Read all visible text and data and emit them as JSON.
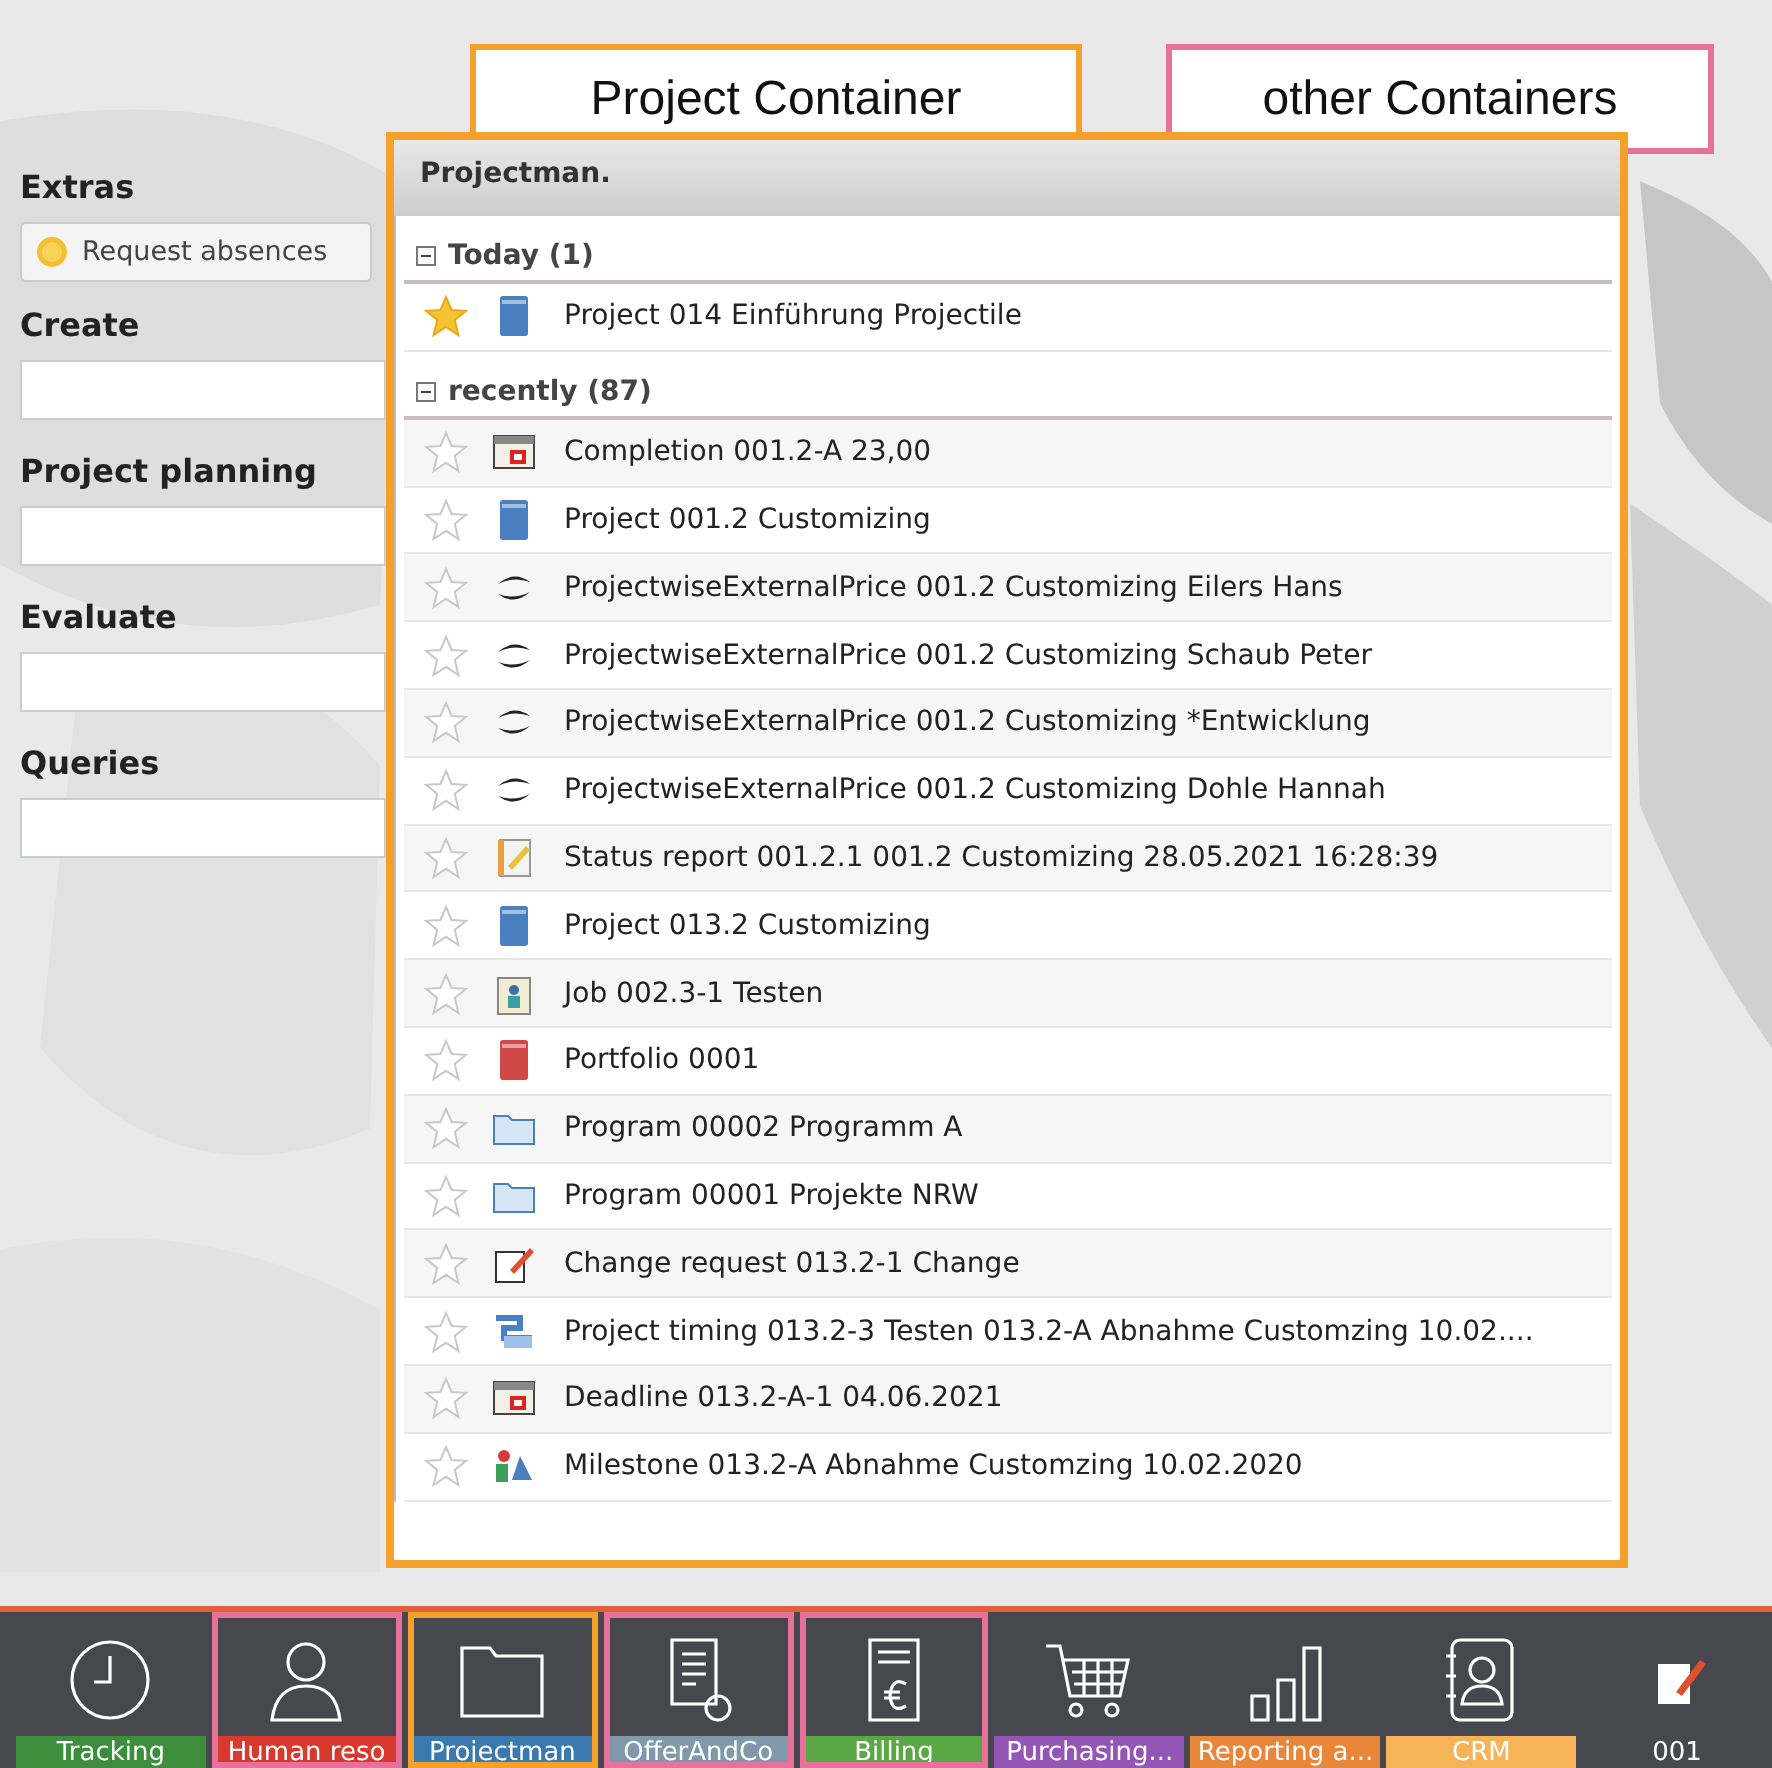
{
  "annotations": [
    {
      "label": "Project Container",
      "color": "#f5a02a"
    },
    {
      "label": "other Containers",
      "color": "#e8719a"
    }
  ],
  "sidebar": {
    "extras_heading": "Extras",
    "absence_button": "Request absences",
    "sections": [
      {
        "heading": "Create"
      },
      {
        "heading": "Project planning"
      },
      {
        "heading": "Evaluate"
      },
      {
        "heading": "Queries"
      }
    ]
  },
  "panel": {
    "title": "Projectman.",
    "groups": [
      {
        "label": "Today (1)",
        "expanded": true,
        "items": [
          {
            "kind": "project",
            "text": "Project 014 Einführung Projectile",
            "favorite": true
          }
        ]
      },
      {
        "label": "recently (87)",
        "expanded": true,
        "items": [
          {
            "kind": "calendar",
            "text": "Completion 001.2-A 23,00",
            "favorite": false
          },
          {
            "kind": "project",
            "text": "Project 001.2 Customizing",
            "favorite": false
          },
          {
            "kind": "price",
            "text": "ProjectwiseExternalPrice 001.2 Customizing Eilers Hans",
            "favorite": false
          },
          {
            "kind": "price",
            "text": "ProjectwiseExternalPrice 001.2 Customizing Schaub Peter",
            "favorite": false
          },
          {
            "kind": "price",
            "text": "ProjectwiseExternalPrice 001.2 Customizing *Entwicklung",
            "favorite": false
          },
          {
            "kind": "price",
            "text": "ProjectwiseExternalPrice 001.2 Customizing Dohle Hannah",
            "favorite": false
          },
          {
            "kind": "report",
            "text": "Status report 001.2.1 001.2 Customizing 28.05.2021 16:28:39",
            "favorite": false
          },
          {
            "kind": "project",
            "text": "Project 013.2 Customizing",
            "favorite": false
          },
          {
            "kind": "job",
            "text": "Job 002.3-1 Testen",
            "favorite": false
          },
          {
            "kind": "portfolio",
            "text": "Portfolio 0001",
            "favorite": false
          },
          {
            "kind": "folder",
            "text": "Program 00002 Programm A",
            "favorite": false
          },
          {
            "kind": "folder",
            "text": "Program 00001 Projekte NRW",
            "favorite": false
          },
          {
            "kind": "change",
            "text": "Change request 013.2-1 Change",
            "favorite": false
          },
          {
            "kind": "timing",
            "text": "Project timing 013.2-3 Testen 013.2-A Abnahme Customzing 10.02....",
            "favorite": false
          },
          {
            "kind": "calendar",
            "text": "Deadline 013.2-A-1 04.06.2021",
            "favorite": false
          },
          {
            "kind": "milestone",
            "text": "Milestone 013.2-A Abnahme Customzing 10.02.2020",
            "favorite": false
          }
        ]
      }
    ]
  },
  "dock": [
    {
      "kind": "clock",
      "label": "Tracking",
      "color": "#3c8d3c"
    },
    {
      "kind": "person",
      "label": "Human reso",
      "color": "#d8392f",
      "frame": {
        "color": "#e8719a"
      }
    },
    {
      "kind": "folder",
      "label": "Projectman",
      "color": "#3a79ad",
      "frame": {
        "color": "#f5a02a"
      }
    },
    {
      "kind": "document",
      "label": "OfferAndCo",
      "color": "#7f98aa",
      "frame": {
        "color": "#e8719a"
      }
    },
    {
      "kind": "invoice",
      "label": "Billing",
      "color": "#5aa845",
      "frame": {
        "color": "#e8719a"
      }
    },
    {
      "kind": "cart",
      "label": "Purchasing...",
      "color": "#9356b5"
    },
    {
      "kind": "bars",
      "label": "Reporting a...",
      "color": "#e8873a"
    },
    {
      "kind": "contact",
      "label": "CRM",
      "color": "#f6b456"
    },
    {
      "kind": "note",
      "label": "001"
    }
  ]
}
